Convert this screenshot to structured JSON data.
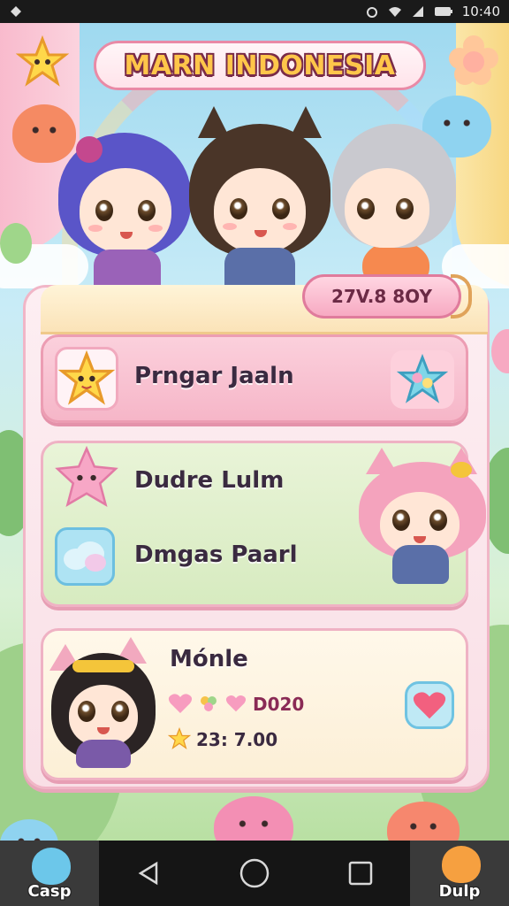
{
  "status_bar": {
    "time": "10:40"
  },
  "game": {
    "title": "MARN INDONESIA",
    "ribbon_label": "27V.8 8OY"
  },
  "menu": {
    "item1_label": "Prngar Jaaln",
    "item2_label": "Dudre Lulm",
    "item3_label": "Dmgas Paarl",
    "profile": {
      "name": "Mónle",
      "hearts_value": "D020",
      "stars_value": "23: 7.00"
    }
  },
  "nav": {
    "left_label": "Casp",
    "right_label": "Dulp"
  },
  "colors": {
    "accent_pink": "#f6b6c8",
    "title_gold": "#ffc64a",
    "title_outline": "#7a2b47"
  },
  "icons": [
    "star-icon",
    "flower-icon",
    "cloud-icon",
    "heart-icon",
    "back-icon",
    "home-icon",
    "recents-icon"
  ]
}
